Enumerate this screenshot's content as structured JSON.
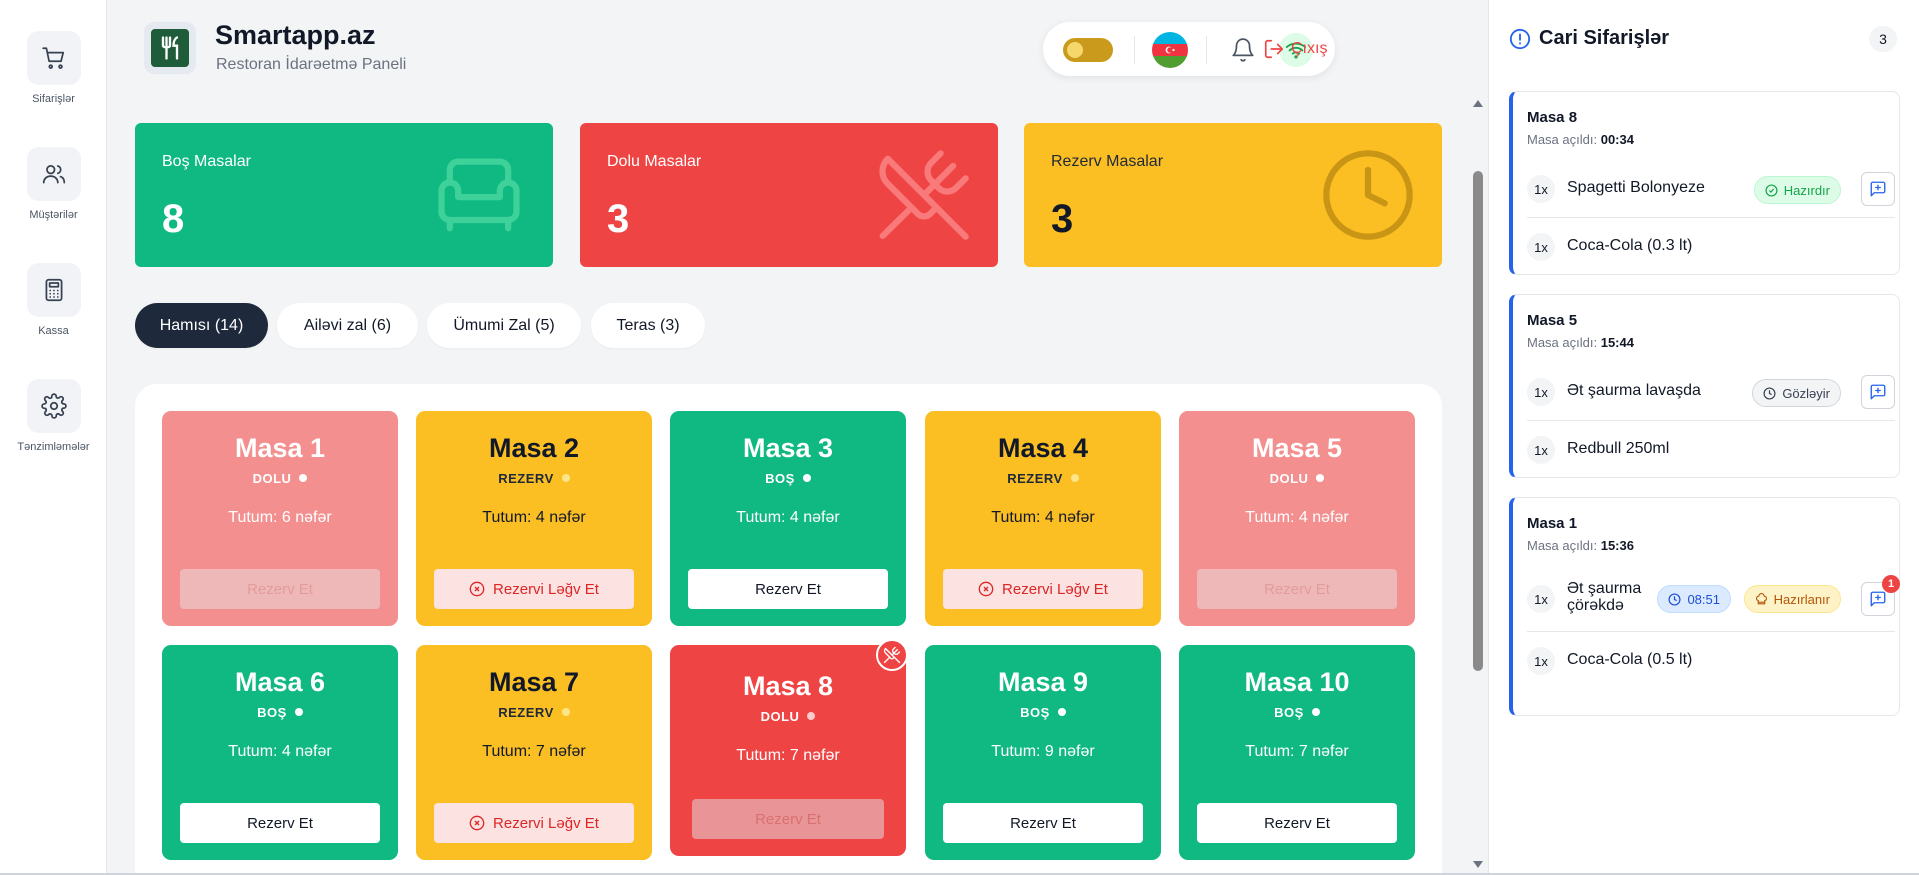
{
  "sidebar": {
    "items": [
      {
        "label": "Sifarişlər",
        "icon": "cart-icon"
      },
      {
        "label": "Müştərilər",
        "icon": "users-icon"
      },
      {
        "label": "Kassa",
        "icon": "calculator-icon"
      },
      {
        "label": "Tənzimləmələr",
        "icon": "gear-icon"
      }
    ]
  },
  "header": {
    "title": "Smartapp.az",
    "subtitle": "Restoran İdarəetmə Paneli",
    "logout_label": "Çıxış"
  },
  "stats": [
    {
      "label": "Boş Masalar",
      "value": "8",
      "icon": "armchair-icon",
      "color": "#10b981"
    },
    {
      "label": "Dolu Masalar",
      "value": "3",
      "icon": "utensils-icon",
      "color": "#ef4444"
    },
    {
      "label": "Rezerv Masalar",
      "value": "3",
      "icon": "clock-icon",
      "color": "#fbbf24"
    }
  ],
  "tabs": [
    {
      "label": "Hamısı (14)",
      "active": true
    },
    {
      "label": "Ailəvi zal (6)"
    },
    {
      "label": "Ümumi Zal (5)"
    },
    {
      "label": "Teras (3)"
    }
  ],
  "tables": [
    {
      "name": "Masa 1",
      "status": "DOLU",
      "capacity": "Tutum: 6 nəfər",
      "button": "Rezerv Et"
    },
    {
      "name": "Masa 2",
      "status": "REZERV",
      "capacity": "Tutum: 4 nəfər",
      "button": "Rezervi Ləğv Et"
    },
    {
      "name": "Masa 3",
      "status": "BOŞ",
      "capacity": "Tutum: 4 nəfər",
      "button": "Rezerv Et"
    },
    {
      "name": "Masa 4",
      "status": "REZERV",
      "capacity": "Tutum: 4 nəfər",
      "button": "Rezervi Ləğv Et"
    },
    {
      "name": "Masa 5",
      "status": "DOLU",
      "capacity": "Tutum: 4 nəfər",
      "button": "Rezerv Et"
    },
    {
      "name": "Masa 6",
      "status": "BOŞ",
      "capacity": "Tutum: 4 nəfər",
      "button": "Rezerv Et"
    },
    {
      "name": "Masa 7",
      "status": "REZERV",
      "capacity": "Tutum: 7 nəfər",
      "button": "Rezervi Ləğv Et"
    },
    {
      "name": "Masa 8",
      "status": "DOLU",
      "capacity": "Tutum: 7 nəfər",
      "button": "Rezerv Et"
    },
    {
      "name": "Masa 9",
      "status": "BOŞ",
      "capacity": "Tutum: 9 nəfər",
      "button": "Rezerv Et"
    },
    {
      "name": "Masa 10",
      "status": "BOŞ",
      "capacity": "Tutum: 7 nəfər",
      "button": "Rezerv Et"
    }
  ],
  "orders_panel": {
    "title": "Cari Sifarişlər",
    "count": "3",
    "opened_label": "Masa açıldı:",
    "orders": [
      {
        "table": "Masa 8",
        "time": "00:34",
        "items": [
          {
            "qty": "1x",
            "name": "Spagetti Bolonyeze",
            "status": "Hazırdır"
          },
          {
            "qty": "1x",
            "name": "Coca-Cola (0.3 lt)"
          }
        ]
      },
      {
        "table": "Masa 5",
        "time": "15:44",
        "items": [
          {
            "qty": "1x",
            "name": "Ət şaurma lavaşda",
            "status": "Gözləyir"
          },
          {
            "qty": "1x",
            "name": "Redbull 250ml"
          }
        ]
      },
      {
        "table": "Masa 1",
        "time": "15:36",
        "items": [
          {
            "qty": "1x",
            "name_line1": "Ət şaurma",
            "name_line2": "çörəkdə",
            "timer": "08:51",
            "status": "Hazırlanır",
            "note_count": "1"
          },
          {
            "qty": "1x",
            "name": "Coca-Cola (0.5 lt)"
          }
        ]
      }
    ]
  },
  "colors": {
    "green": "#10b981",
    "red": "#ef4444",
    "pink": "#f38f8f",
    "yellow": "#fbbf24",
    "dark": "#1e293b",
    "accent_blue": "#2563eb"
  }
}
